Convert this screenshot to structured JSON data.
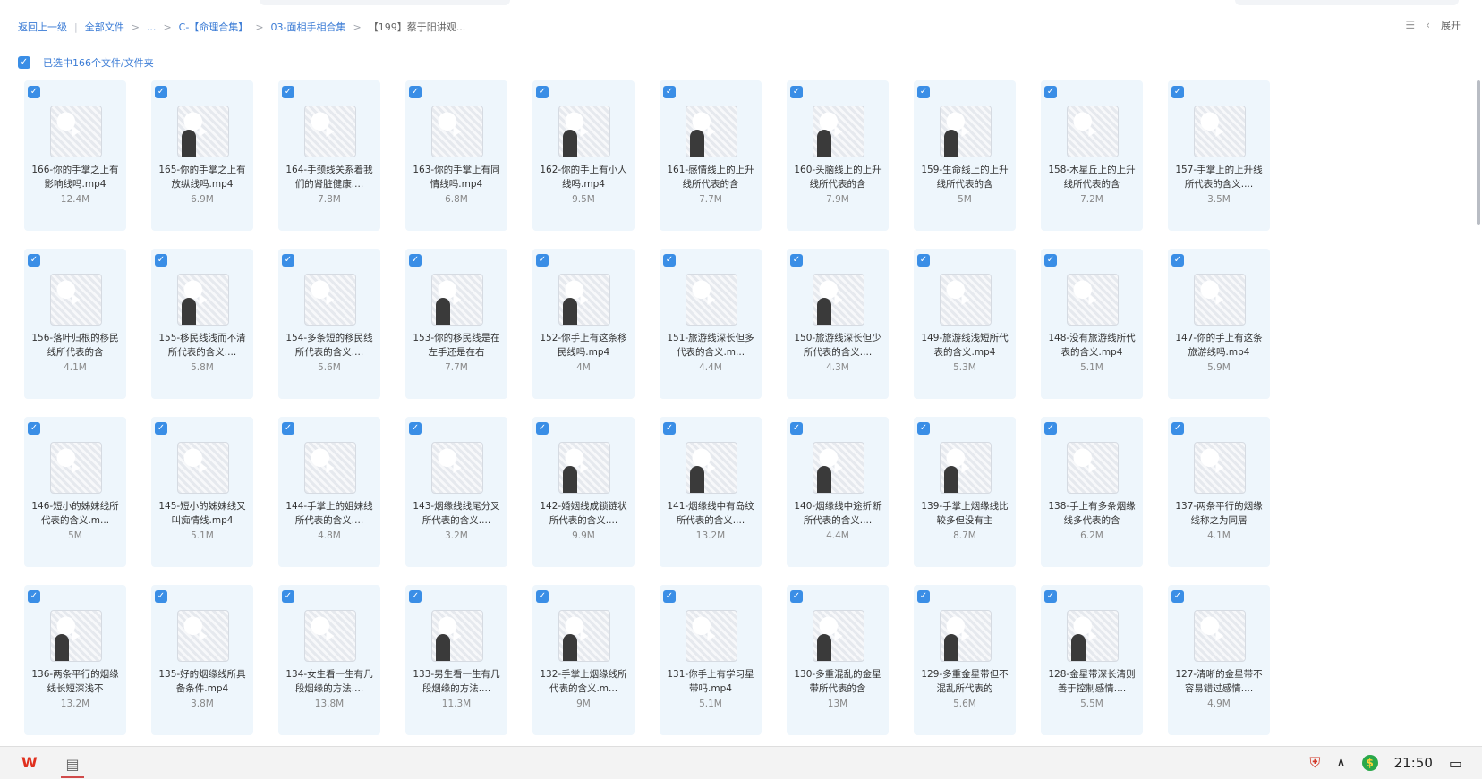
{
  "breadcrumb": {
    "back": "返回上一级",
    "all_files": "全部文件",
    "ellipsis": "...",
    "folder1": "C-【命理合集】",
    "folder2": "03-面相手相合集",
    "current": "【199】蔡于阳讲观..."
  },
  "top_right": {
    "expand_label": "展开",
    "list_icon": "list-view-icon",
    "back_icon": "chevron-left-icon"
  },
  "selection": {
    "label": "已选中166个文件/文件夹"
  },
  "files": [
    {
      "name": "166-你的手掌之上有影响线吗.mp4",
      "size": "12.4M",
      "person": false
    },
    {
      "name": "165-你的手掌之上有放纵线吗.mp4",
      "size": "6.9M",
      "person": true
    },
    {
      "name": "164-手颈线关系着我们的肾脏健康....",
      "size": "7.8M",
      "person": false
    },
    {
      "name": "163-你的手掌上有同情线吗.mp4",
      "size": "6.8M",
      "person": false
    },
    {
      "name": "162-你的手上有小人线吗.mp4",
      "size": "9.5M",
      "person": true
    },
    {
      "name": "161-感情线上的上升线所代表的含",
      "size": "7.7M",
      "person": true
    },
    {
      "name": "160-头脑线上的上升线所代表的含",
      "size": "7.9M",
      "person": true
    },
    {
      "name": "159-生命线上的上升线所代表的含",
      "size": "5M",
      "person": true
    },
    {
      "name": "158-木星丘上的上升线所代表的含",
      "size": "7.2M",
      "person": false
    },
    {
      "name": "157-手掌上的上升线所代表的含义....",
      "size": "3.5M",
      "person": false
    },
    {
      "name": "156-落叶归根的移民线所代表的含",
      "size": "4.1M",
      "person": false
    },
    {
      "name": "155-移民线浅而不清所代表的含义....",
      "size": "5.8M",
      "person": true
    },
    {
      "name": "154-多条短的移民线所代表的含义....",
      "size": "5.6M",
      "person": false
    },
    {
      "name": "153-你的移民线是在左手还是在右",
      "size": "7.7M",
      "person": true
    },
    {
      "name": "152-你手上有这条移民线吗.mp4",
      "size": "4M",
      "person": true
    },
    {
      "name": "151-旅游线深长但多代表的含义.m...",
      "size": "4.4M",
      "person": false
    },
    {
      "name": "150-旅游线深长但少所代表的含义....",
      "size": "4.3M",
      "person": true
    },
    {
      "name": "149-旅游线浅短所代表的含义.mp4",
      "size": "5.3M",
      "person": false
    },
    {
      "name": "148-没有旅游线所代表的含义.mp4",
      "size": "5.1M",
      "person": false
    },
    {
      "name": "147-你的手上有这条旅游线吗.mp4",
      "size": "5.9M",
      "person": false
    },
    {
      "name": "146-短小的姊妹线所代表的含义.m...",
      "size": "5M",
      "person": false
    },
    {
      "name": "145-短小的姊妹线又叫痴情线.mp4",
      "size": "5.1M",
      "person": false
    },
    {
      "name": "144-手掌上的姐妹线所代表的含义....",
      "size": "4.8M",
      "person": false
    },
    {
      "name": "143-烟缘线线尾分叉所代表的含义....",
      "size": "3.2M",
      "person": false
    },
    {
      "name": "142-婚姻线成锁链状所代表的含义....",
      "size": "9.9M",
      "person": true
    },
    {
      "name": "141-烟缘线中有岛纹所代表的含义....",
      "size": "13.2M",
      "person": true
    },
    {
      "name": "140-烟缘线中途折断所代表的含义....",
      "size": "4.4M",
      "person": true
    },
    {
      "name": "139-手掌上烟缘线比较多但没有主",
      "size": "8.7M",
      "person": true
    },
    {
      "name": "138-手上有多条烟缘线多代表的含",
      "size": "6.2M",
      "person": false
    },
    {
      "name": "137-两条平行的烟缘线称之为同居",
      "size": "4.1M",
      "person": false
    },
    {
      "name": "136-两条平行的烟缘线长短深浅不",
      "size": "13.2M",
      "person": true
    },
    {
      "name": "135-好的烟缘线所具备条件.mp4",
      "size": "3.8M",
      "person": false
    },
    {
      "name": "134-女生看一生有几段烟缘的方法....",
      "size": "13.8M",
      "person": false
    },
    {
      "name": "133-男生看一生有几段烟缘的方法....",
      "size": "11.3M",
      "person": true
    },
    {
      "name": "132-手掌上烟缘线所代表的含义.m...",
      "size": "9M",
      "person": true
    },
    {
      "name": "131-你手上有学习星带吗.mp4",
      "size": "5.1M",
      "person": false
    },
    {
      "name": "130-多重混乱的金星带所代表的含",
      "size": "13M",
      "person": true
    },
    {
      "name": "129-多重金星带但不混乱所代表的",
      "size": "5.6M",
      "person": true
    },
    {
      "name": "128-金星带深长清则善于控制感情....",
      "size": "5.5M",
      "person": true
    },
    {
      "name": "127-清晰的金星带不容易错过感情....",
      "size": "4.9M",
      "person": false
    }
  ],
  "taskbar": {
    "time": "21:50",
    "apps": [
      "wps-icon",
      "notepad-icon"
    ],
    "tray_icons": [
      "antivirus-icon",
      "chevron-up-icon",
      "coin-icon",
      "message-icon"
    ]
  }
}
